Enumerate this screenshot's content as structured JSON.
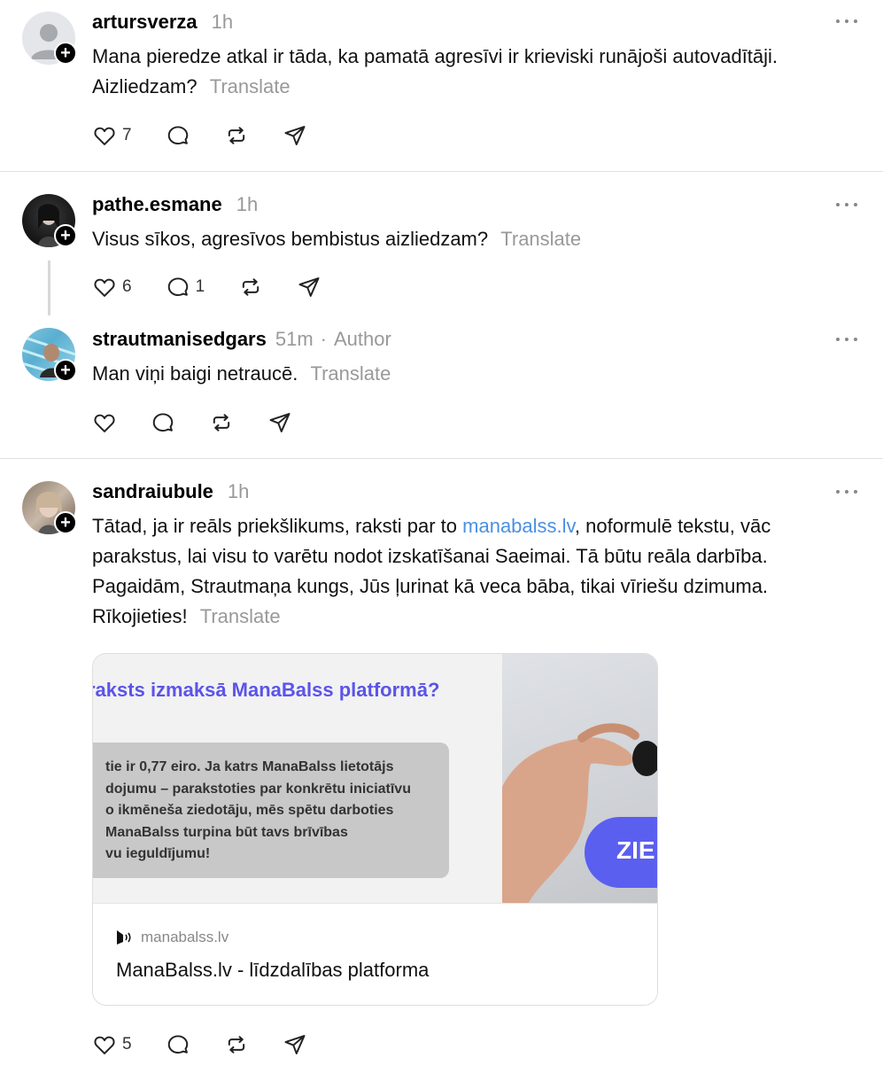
{
  "posts": [
    {
      "username": "artursverza",
      "time": "1h",
      "text": "Mana pieredze atkal ir tāda, ka pamatā agresīvi ir krieviski runājoši autovadītāji. Aizliedzam?",
      "translate": "Translate",
      "likes": "7",
      "replies": "",
      "avatar": "default-avatar"
    },
    {
      "username": "pathe.esmane",
      "time": "1h",
      "text": "Visus sīkos, agresīvos bembistus aizliedzam?",
      "translate": "Translate",
      "likes": "6",
      "replies": "1",
      "avatar": "photo-avatar"
    },
    {
      "username": "strautmanisedgars",
      "time": "51m",
      "separator": "·",
      "author_badge": "Author",
      "text": "Man viņi baigi netraucē.",
      "translate": "Translate",
      "likes": "",
      "replies": "",
      "avatar": "photo-avatar"
    },
    {
      "username": "sandraiubule",
      "time": "1h",
      "text_before": "Tātad, ja ir reāls priekšlikums, raksti par to ",
      "link": "manabalss.lv",
      "text_after": ", noformulē tekstu, vāc parakstus, lai visu to varētu nodot izskatīšanai Saeimai. Tā būtu reāla darbība. Pagaidām, Strautmaņa kungs, Jūs ļurinat kā veca bāba, tikai vīriešu dzimuma. Rīkojieties!",
      "translate": "Translate",
      "likes": "5",
      "replies": "",
      "avatar": "photo-avatar"
    }
  ],
  "link_card": {
    "image_heading": "raksts izmaksā ManaBalss platformā?",
    "image_lines": [
      "tie ir 0,77 eiro. Ja katrs ManaBalss lietotājs",
      "dojumu – parakstoties par konkrētu iniciatīvu",
      "o ikmēneša ziedotāju, mēs spētu darboties",
      " ManaBalss turpina būt tavs brīvības",
      "vu ieguldījumu!"
    ],
    "image_button": "ZIE",
    "domain": "manabalss.lv",
    "title": "ManaBalss.lv - līdzdalības platforma"
  },
  "colors": {
    "link": "#4a90e2",
    "muted": "#999999",
    "card_accent": "#5b54e8"
  }
}
